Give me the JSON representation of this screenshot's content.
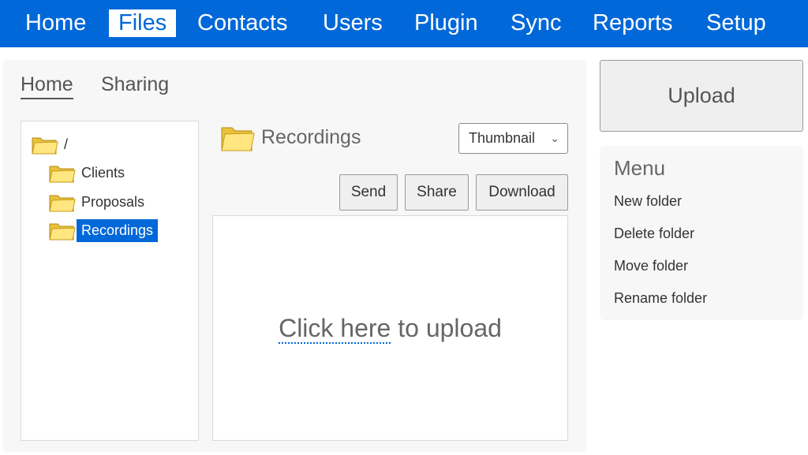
{
  "nav": {
    "items": [
      {
        "label": "Home"
      },
      {
        "label": "Files"
      },
      {
        "label": "Contacts"
      },
      {
        "label": "Users"
      },
      {
        "label": "Plugin"
      },
      {
        "label": "Sync"
      },
      {
        "label": "Reports"
      },
      {
        "label": "Setup"
      }
    ],
    "active": "Files",
    "color": "#0068d8"
  },
  "subtabs": [
    {
      "label": "Home",
      "active": true
    },
    {
      "label": "Sharing",
      "active": false
    }
  ],
  "tree": {
    "root": "/",
    "children": [
      "Clients",
      "Proposals",
      "Recordings"
    ],
    "selected": "Recordings"
  },
  "content": {
    "folder_title": "Recordings",
    "view_select": {
      "value": "Thumbnail"
    },
    "buttons": {
      "send": "Send",
      "share": "Share",
      "download": "Download"
    },
    "dropzone": {
      "link": "Click here",
      "rest": " to upload"
    }
  },
  "sidebar": {
    "upload_label": "Upload",
    "menu_title": "Menu",
    "menu_items": [
      "New folder",
      "Delete folder",
      "Move folder",
      "Rename folder"
    ]
  },
  "icons": {
    "folder": "folder-icon",
    "chevron": "chevron-down-icon"
  }
}
